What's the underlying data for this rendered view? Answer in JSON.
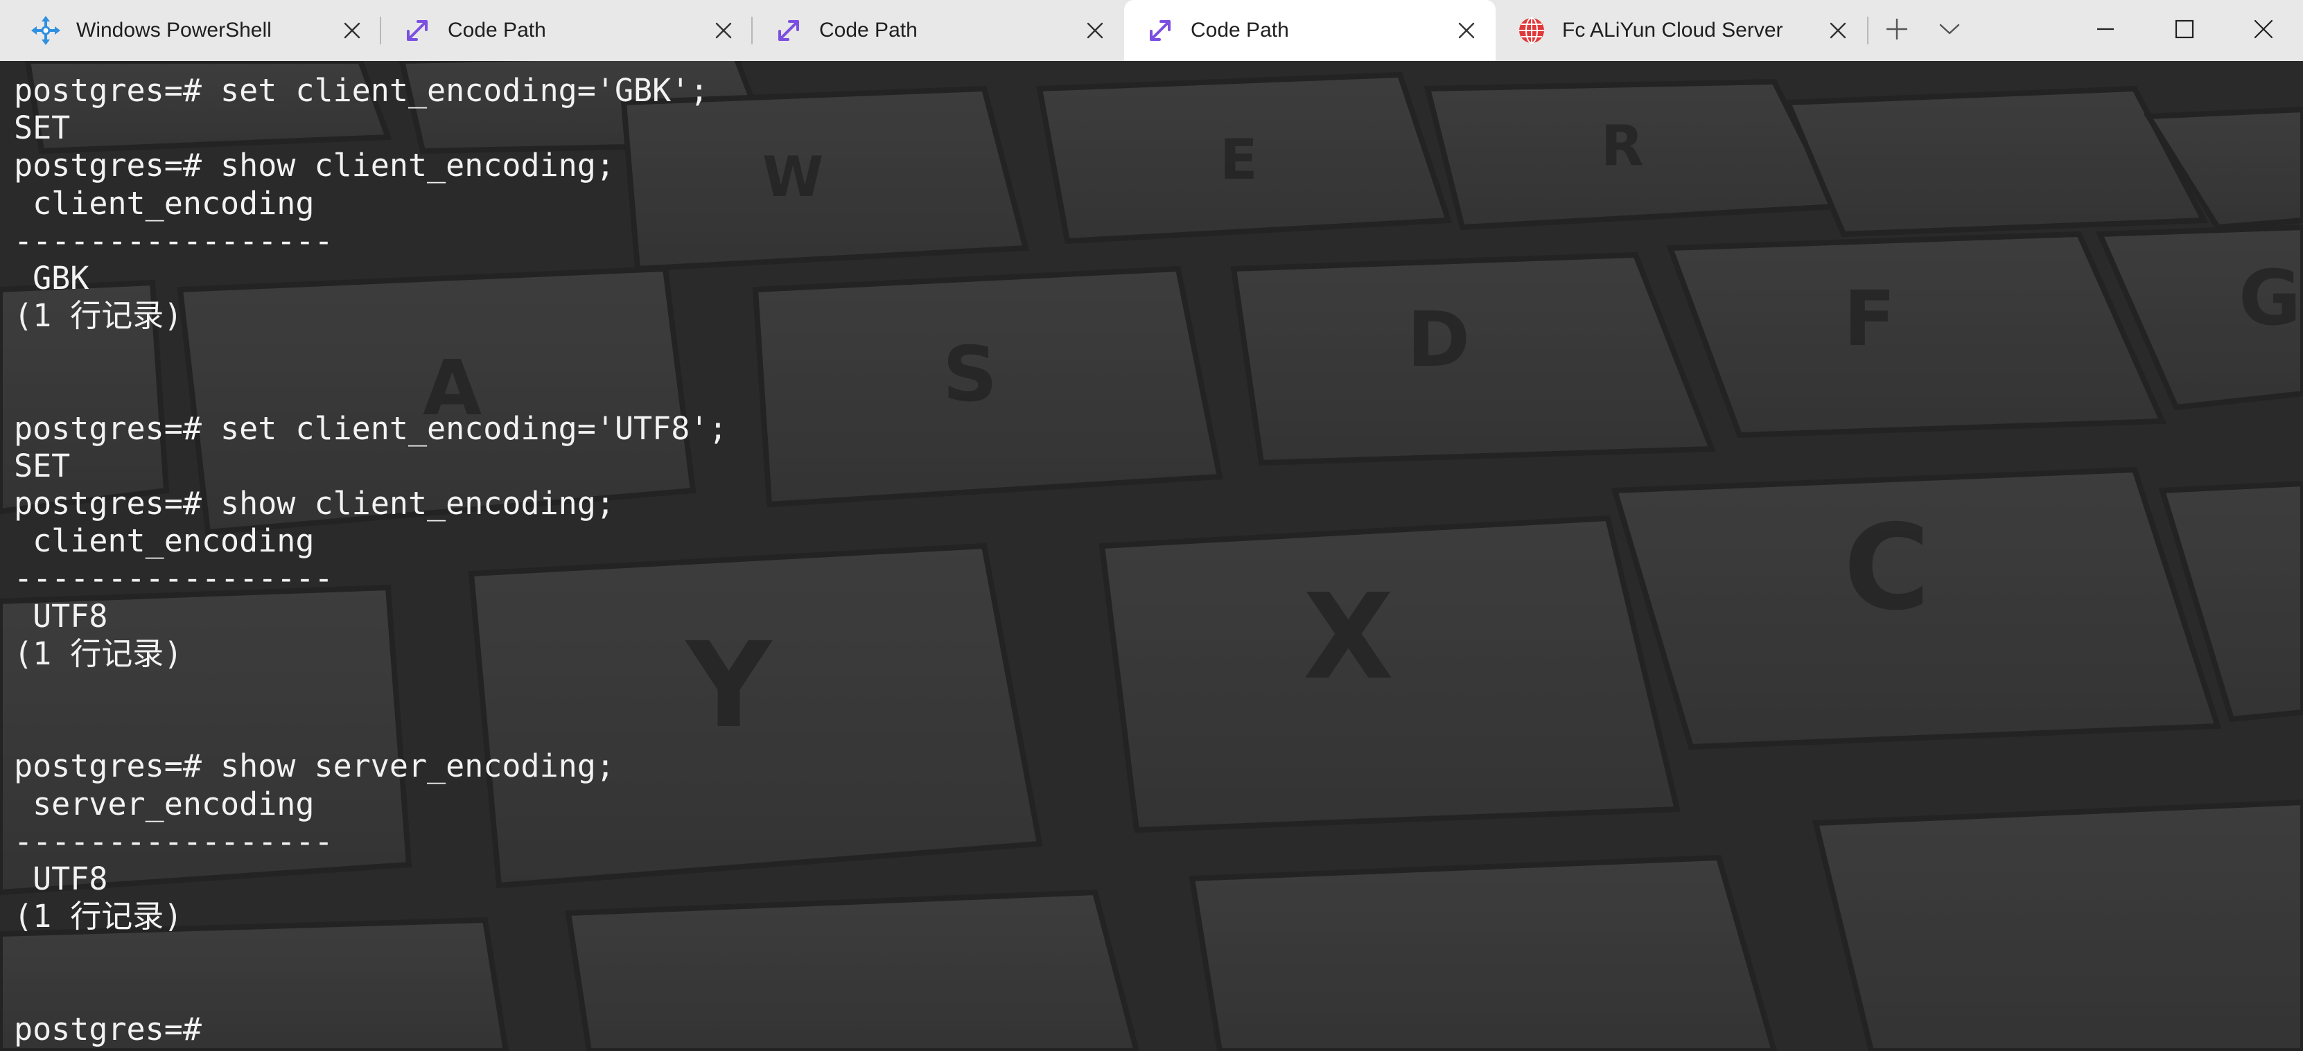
{
  "tabs": [
    {
      "title": "Windows PowerShell",
      "icon": "powershell-icon",
      "active": false
    },
    {
      "title": "Code Path",
      "icon": "expand-arrows-icon",
      "active": false
    },
    {
      "title": "Code Path",
      "icon": "expand-arrows-icon",
      "active": false
    },
    {
      "title": "Code Path",
      "icon": "expand-arrows-icon",
      "active": true
    },
    {
      "title": "Fc ALiYun Cloud Server",
      "icon": "globe-icon",
      "active": false
    }
  ],
  "controls": {
    "new_tab": "plus-icon",
    "dropdown": "chevron-down-icon",
    "minimize": "minimize-icon",
    "maximize": "maximize-icon",
    "close": "close-icon"
  },
  "colors": {
    "tabbar_bg": "#e8e8e8",
    "active_tab_bg": "#ffffff",
    "terminal_bg": "#333333",
    "terminal_text": "#f2f2f2",
    "accent_purple": "#7b4fe0",
    "accent_red": "#e0393b"
  },
  "terminal": {
    "lines": [
      "postgres=# set client_encoding='GBK';",
      "SET",
      "postgres=# show client_encoding;",
      " client_encoding",
      "-----------------",
      " GBK",
      "(1 行记录)",
      "",
      "",
      "postgres=# set client_encoding='UTF8';",
      "SET",
      "postgres=# show client_encoding;",
      " client_encoding",
      "-----------------",
      " UTF8",
      "(1 行记录)",
      "",
      "",
      "postgres=# show server_encoding;",
      " server_encoding",
      "-----------------",
      " UTF8",
      "(1 行记录)",
      "",
      "",
      "postgres=#"
    ]
  }
}
